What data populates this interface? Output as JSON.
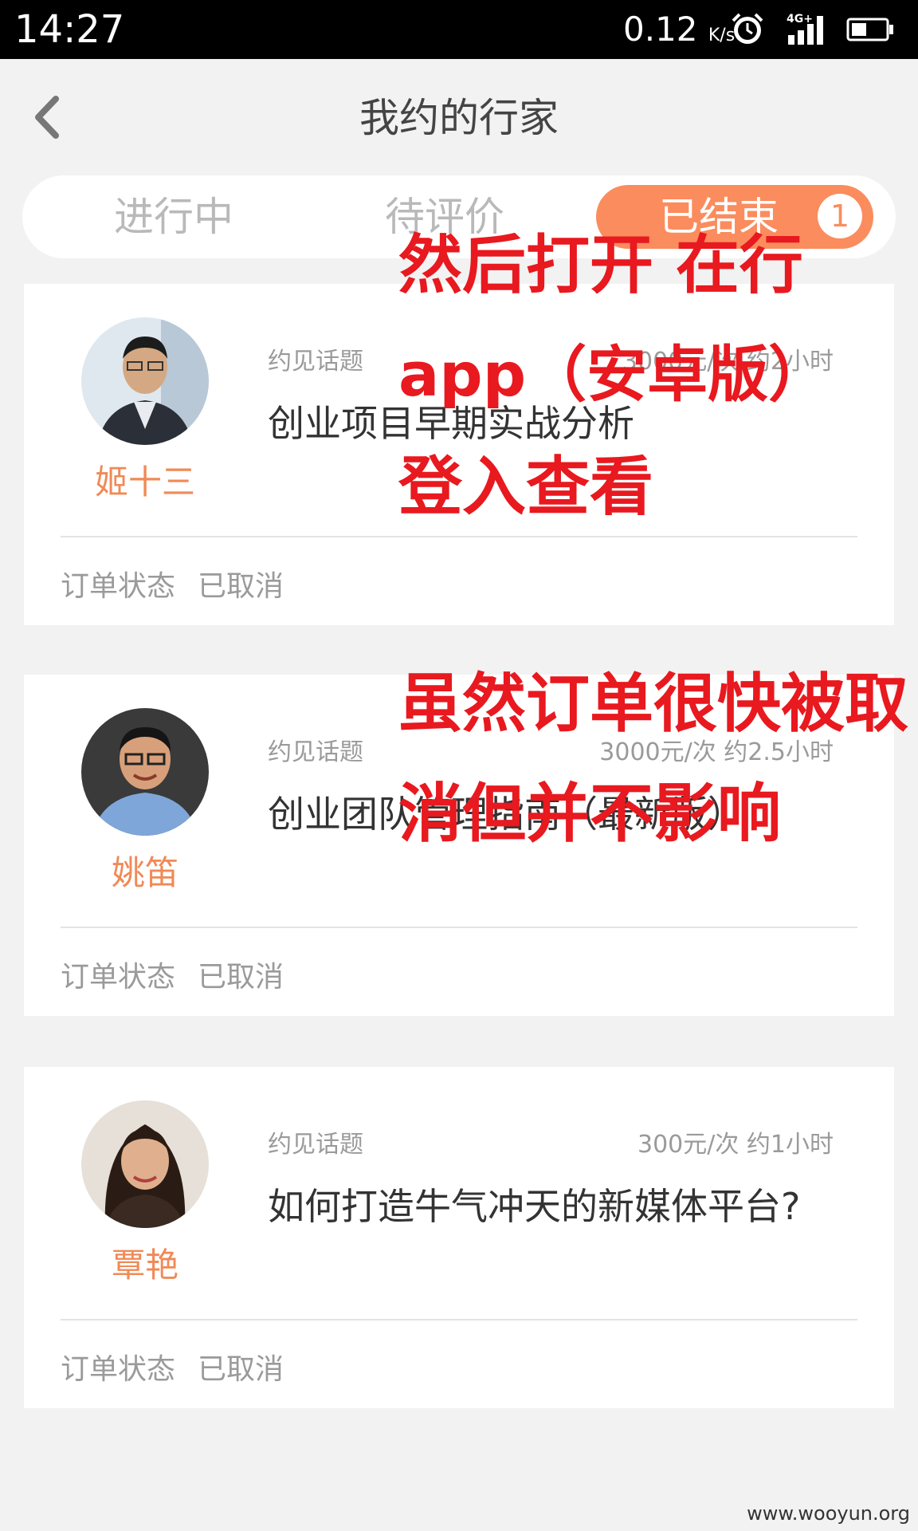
{
  "status_bar": {
    "time": "14:27",
    "net_speed": "0.12",
    "net_unit": "K/s",
    "network": "4G+"
  },
  "header": {
    "title": "我约的行家"
  },
  "tabs": [
    {
      "label": "进行中"
    },
    {
      "label": "待评价"
    },
    {
      "label": "已结束",
      "badge": "1"
    }
  ],
  "orders": [
    {
      "expert": "姬十三",
      "topic_label": "约见话题",
      "price": "3000元/次  约2小时",
      "topic": "创业项目早期实战分析",
      "status_label": "订单状态",
      "status_value": "已取消"
    },
    {
      "expert": "姚笛",
      "topic_label": "约见话题",
      "price": "3000元/次  约2.5小时",
      "topic": "创业团队管理指南（最新版）",
      "status_label": "订单状态",
      "status_value": "已取消"
    },
    {
      "expert": "覃艳",
      "topic_label": "约见话题",
      "price": "300元/次  约1小时",
      "topic": "如何打造牛气冲天的新媒体平台?",
      "status_label": "订单状态",
      "status_value": "已取消"
    }
  ],
  "annotations": {
    "line1": "然后打开 在行",
    "line2": "app（安卓版）",
    "line3": "登入查看",
    "line4": "虽然订单很快被取",
    "line5": "消但并不影响"
  },
  "watermark": "www.wooyun.org",
  "colors": {
    "accent": "#fb8c5d",
    "expert_name": "#f08a57",
    "annotation_red": "#e8191f",
    "background": "#f2f2f2"
  }
}
